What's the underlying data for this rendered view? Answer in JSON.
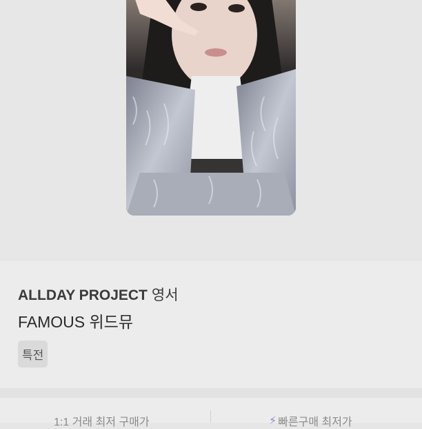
{
  "product": {
    "artist": "ALLDAY PROJECT",
    "member": "영서",
    "album": "FAMOUS 위드뮤",
    "tag": "특전"
  },
  "price_bar": {
    "left_label": "1:1 거래 최저 구매가",
    "right_label": "빠른구매 최저가",
    "right_icon": "lightning-icon"
  },
  "colors": {
    "background": "#e6e6e6",
    "panel": "#ececec",
    "accent_lightning": "#8f86c8"
  }
}
